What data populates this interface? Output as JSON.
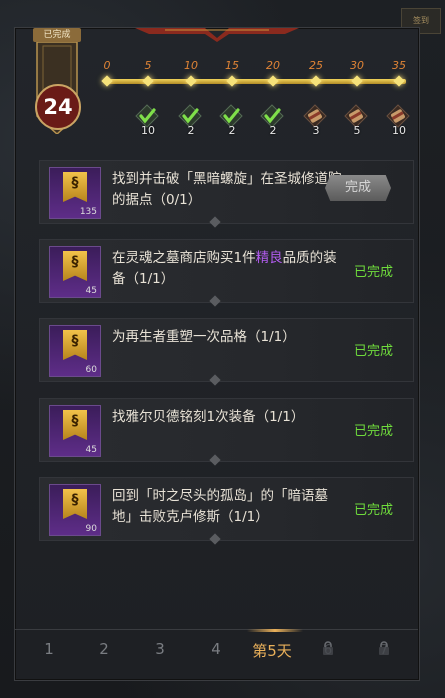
{
  "corner_badge": "签到",
  "level": {
    "done_label": "已完成",
    "value": "24"
  },
  "progress": {
    "ticks": [
      "0",
      "5",
      "10",
      "15",
      "20",
      "25",
      "30",
      "35"
    ],
    "rewards": [
      {
        "type": "check-icon",
        "count": "10",
        "claimed": true
      },
      {
        "type": "check-icon",
        "count": "2",
        "claimed": true
      },
      {
        "type": "check-icon",
        "count": "2",
        "claimed": true
      },
      {
        "type": "check-icon",
        "count": "2",
        "claimed": true
      },
      {
        "type": "scroll-icon",
        "count": "3",
        "claimed": false
      },
      {
        "type": "scroll-icon",
        "count": "5",
        "claimed": false
      },
      {
        "type": "scroll-icon",
        "count": "10",
        "claimed": false
      }
    ]
  },
  "tasks": [
    {
      "text_a": "找到并击破「黑暗螺旋」在圣城修道院的据点（0/1）",
      "points": "135",
      "status": "完成",
      "state": "button"
    },
    {
      "text_a": "在灵魂之墓商店购买1件",
      "text_hl": "精良",
      "text_b": "品质的装备（1/1）",
      "points": "45",
      "status": "已完成",
      "state": "done"
    },
    {
      "text_a": "为再生者重塑一次品格（1/1）",
      "points": "60",
      "status": "已完成",
      "state": "done"
    },
    {
      "text_a": "找雅尔贝德铭刻1次装备（1/1）",
      "points": "45",
      "status": "已完成",
      "state": "done"
    },
    {
      "text_a": "回到「时之尽头的孤岛」的「暗语墓地」击败克卢修斯（1/1）",
      "points": "90",
      "status": "已完成",
      "state": "done"
    }
  ],
  "tabs": [
    "1",
    "2",
    "3",
    "4",
    "第5天",
    "6",
    "7"
  ],
  "active_tab": "第5天",
  "colors": {
    "accent": "#e9b05a",
    "done": "#6fdc3c",
    "highlight": "#b35cf0",
    "track": "#f2d35a"
  }
}
